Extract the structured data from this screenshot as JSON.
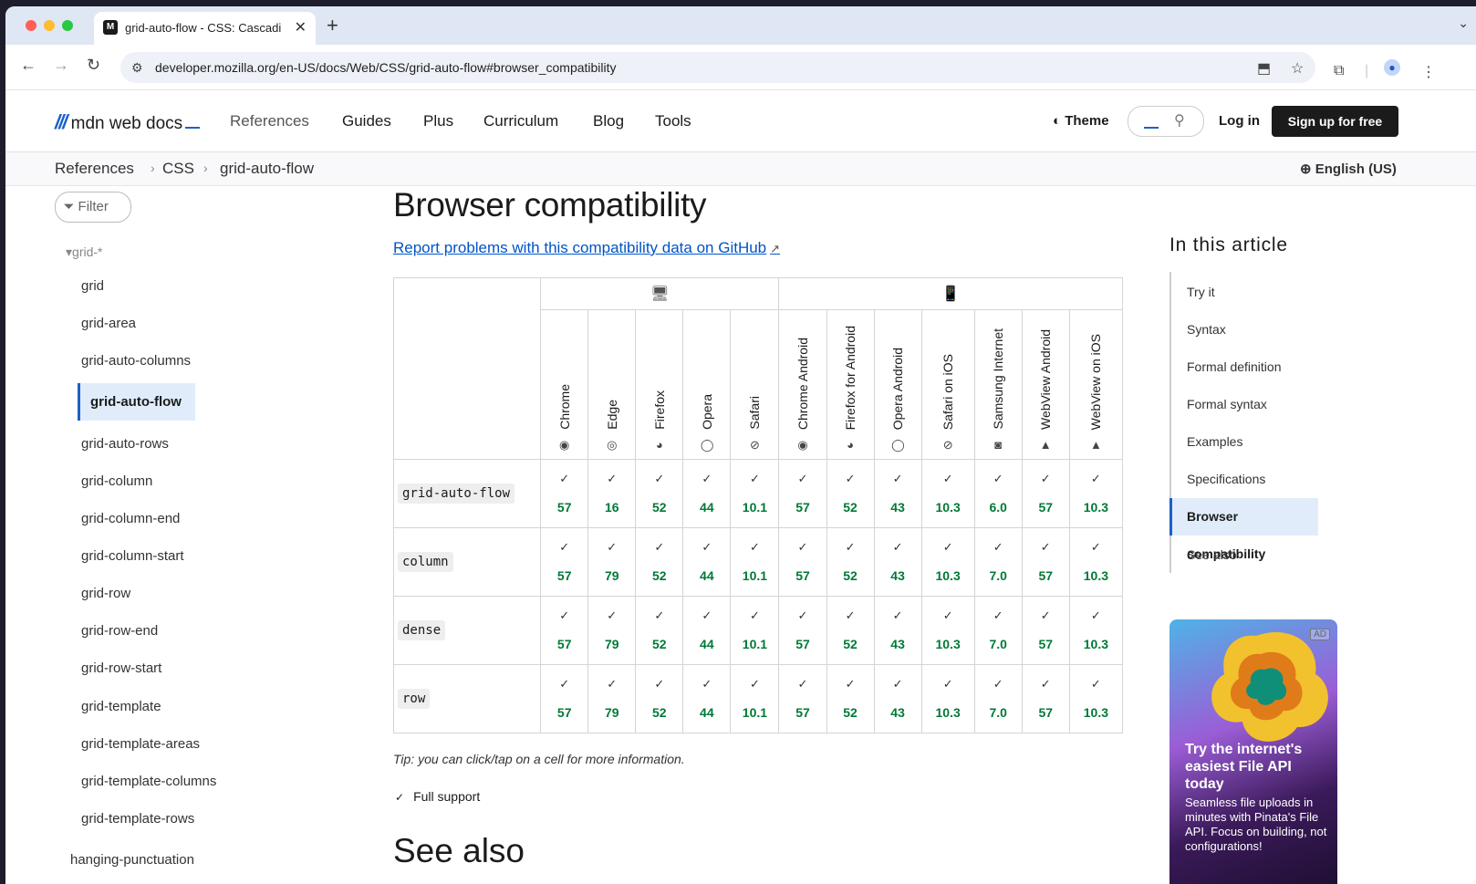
{
  "browser": {
    "tab_title": "grid-auto-flow - CSS: Cascading Style Sheets | MDN",
    "tab_favicon": "M",
    "url": "developer.mozilla.org/en-US/docs/Web/CSS/grid-auto-flow#browser_compatibility",
    "colors": {
      "close": "#ff5f57",
      "minimize": "#febc2e",
      "zoom": "#28c840"
    }
  },
  "header": {
    "logo_text": "mdn web docs",
    "nav": [
      "References",
      "Guides",
      "Plus",
      "Curriculum",
      "Blog",
      "Tools"
    ],
    "theme_label": "Theme",
    "login_label": "Log in",
    "signup_label": "Sign up for free"
  },
  "breadcrumbs": [
    "References",
    "CSS",
    "grid-auto-flow"
  ],
  "language": "English (US)",
  "sidebar": {
    "filter_label": "Filter",
    "group_label": "grid-*",
    "items": [
      "grid",
      "grid-area",
      "grid-auto-columns",
      "grid-auto-flow",
      "grid-auto-rows",
      "grid-column",
      "grid-column-end",
      "grid-column-start",
      "grid-row",
      "grid-row-end",
      "grid-row-start",
      "grid-template",
      "grid-template-areas",
      "grid-template-columns",
      "grid-template-rows",
      "hanging-punctuation"
    ],
    "active_item": "grid-auto-flow"
  },
  "main": {
    "heading": "Browser compatibility",
    "report_link": "Report problems with this compatibility data on GitHub",
    "tip": "Tip: you can click/tap on a cell for more information.",
    "legend_full_support": "Full support",
    "see_also_heading": "See also"
  },
  "compat_table": {
    "browsers": [
      "Chrome",
      "Edge",
      "Firefox",
      "Opera",
      "Safari",
      "Chrome Android",
      "Firefox for Android",
      "Opera Android",
      "Safari on iOS",
      "Samsung Internet",
      "WebView Android",
      "WebView on iOS"
    ],
    "rows": [
      {
        "feature": "grid-auto-flow",
        "versions": [
          "57",
          "16",
          "52",
          "44",
          "10.1",
          "57",
          "52",
          "43",
          "10.3",
          "6.0",
          "57",
          "10.3"
        ]
      },
      {
        "feature": "column",
        "versions": [
          "57",
          "79",
          "52",
          "44",
          "10.1",
          "57",
          "52",
          "43",
          "10.3",
          "7.0",
          "57",
          "10.3"
        ]
      },
      {
        "feature": "dense",
        "versions": [
          "57",
          "79",
          "52",
          "44",
          "10.1",
          "57",
          "52",
          "43",
          "10.3",
          "7.0",
          "57",
          "10.3"
        ]
      },
      {
        "feature": "row",
        "versions": [
          "57",
          "79",
          "52",
          "44",
          "10.1",
          "57",
          "52",
          "43",
          "10.3",
          "7.0",
          "57",
          "10.3"
        ]
      }
    ],
    "support_color": "#007936"
  },
  "toc": {
    "heading": "In this article",
    "items": [
      "Try it",
      "Syntax",
      "Formal definition",
      "Formal syntax",
      "Examples",
      "Specifications",
      "Browser compatibility",
      "See also"
    ],
    "active_item": "Browser compatibility"
  },
  "ad": {
    "tag": "AD",
    "headline": "Try the internet's easiest File API today",
    "body": "Seamless file uploads in minutes with Pinata's File API. Focus on building, not configurations!"
  }
}
